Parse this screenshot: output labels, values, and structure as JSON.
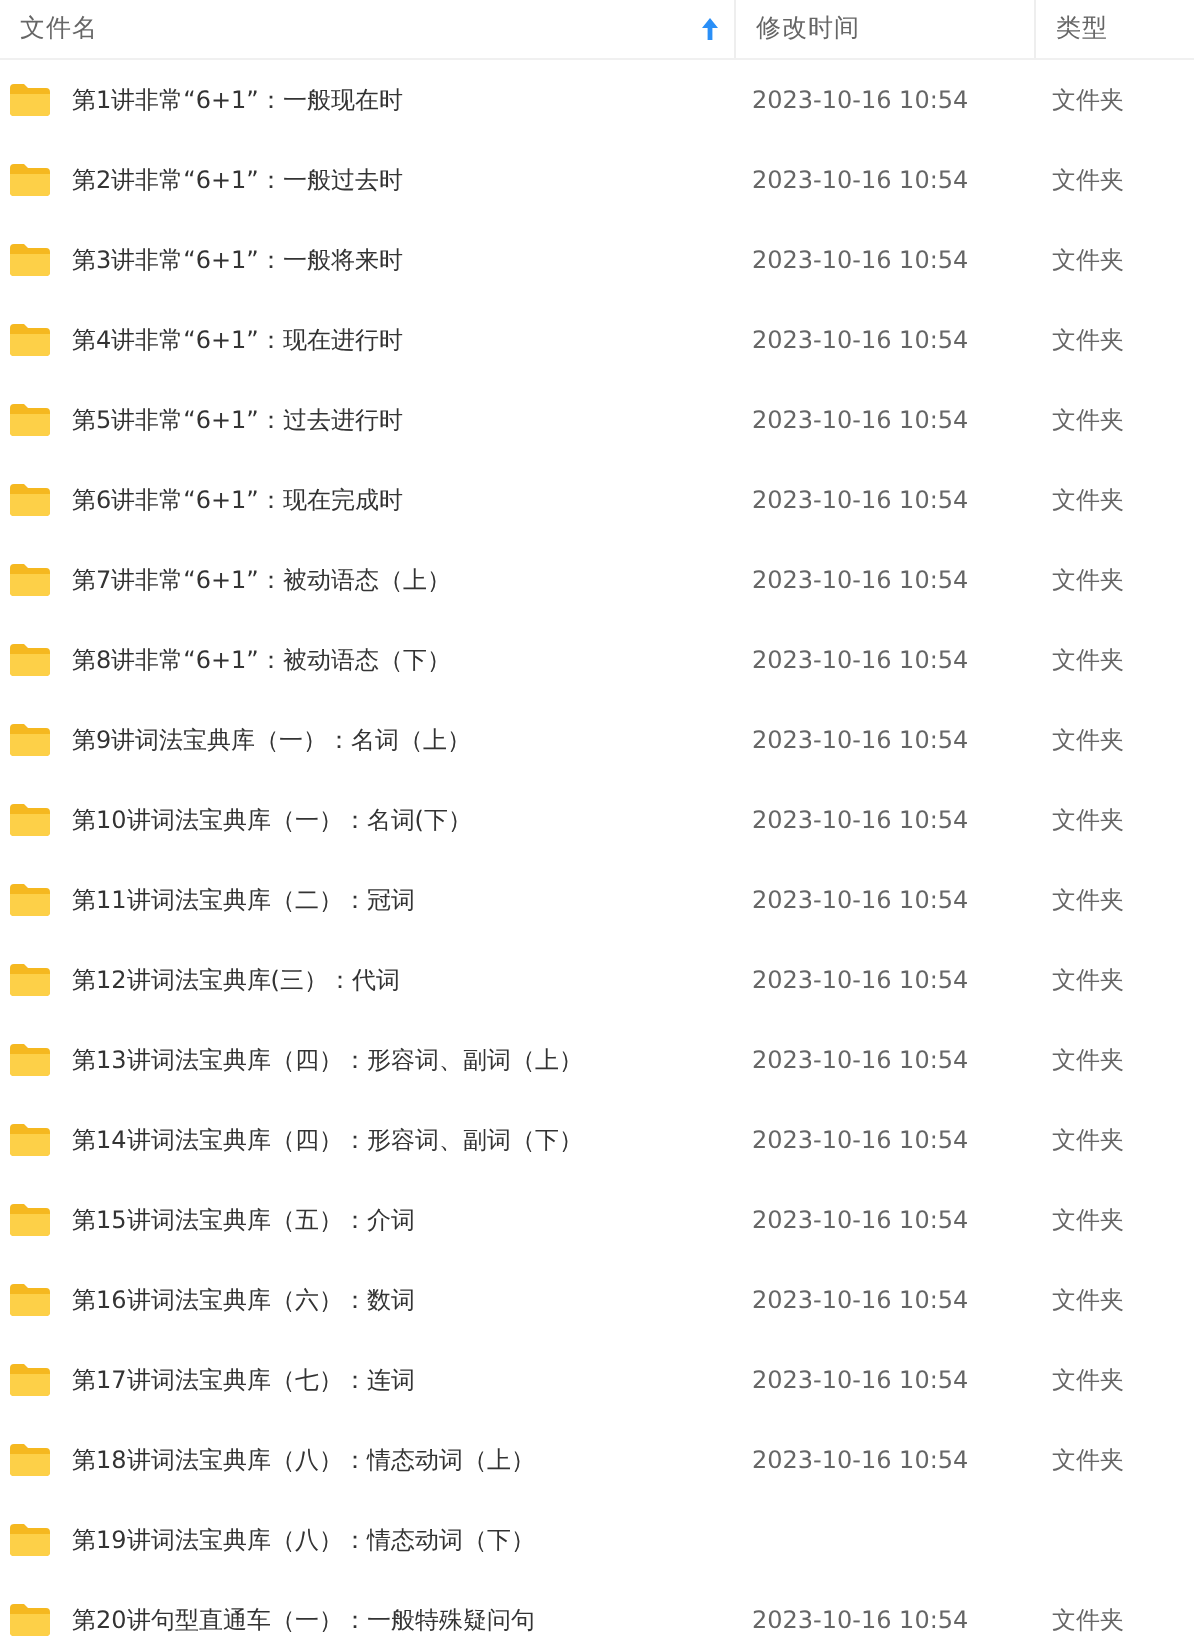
{
  "columns": [
    {
      "label": "文件名",
      "sort_icon": true
    },
    {
      "label": "修改时间",
      "sort_icon": false
    },
    {
      "label": "类型",
      "sort_icon": false
    }
  ],
  "rows": [
    {
      "name": "第1讲非常“6+1”：一般现在时",
      "modified": "2023-10-16 10:54",
      "type": "文件夹"
    },
    {
      "name": "第2讲非常“6+1”：一般过去时",
      "modified": "2023-10-16 10:54",
      "type": "文件夹"
    },
    {
      "name": "第3讲非常“6+1”：一般将来时",
      "modified": "2023-10-16 10:54",
      "type": "文件夹"
    },
    {
      "name": "第4讲非常“6+1”：现在进行时",
      "modified": "2023-10-16 10:54",
      "type": "文件夹"
    },
    {
      "name": "第5讲非常“6+1”：过去进行时",
      "modified": "2023-10-16 10:54",
      "type": "文件夹"
    },
    {
      "name": "第6讲非常“6+1”：现在完成时",
      "modified": "2023-10-16 10:54",
      "type": "文件夹"
    },
    {
      "name": "第7讲非常“6+1”：被动语态（上）",
      "modified": "2023-10-16 10:54",
      "type": "文件夹"
    },
    {
      "name": "第8讲非常“6+1”：被动语态（下）",
      "modified": "2023-10-16 10:54",
      "type": "文件夹"
    },
    {
      "name": "第9讲词法宝典库（一）：名词（上）",
      "modified": "2023-10-16 10:54",
      "type": "文件夹"
    },
    {
      "name": "第10讲词法宝典库（一）：名词(下）",
      "modified": "2023-10-16 10:54",
      "type": "文件夹"
    },
    {
      "name": "第11讲词法宝典库（二）：冠词",
      "modified": "2023-10-16 10:54",
      "type": "文件夹"
    },
    {
      "name": "第12讲词法宝典库(三）：代词",
      "modified": "2023-10-16 10:54",
      "type": "文件夹"
    },
    {
      "name": "第13讲词法宝典库（四）：形容词、副词（上）",
      "modified": "2023-10-16 10:54",
      "type": "文件夹"
    },
    {
      "name": "第14讲词法宝典库（四）：形容词、副词（下）",
      "modified": "2023-10-16 10:54",
      "type": "文件夹"
    },
    {
      "name": "第15讲词法宝典库（五）：介词",
      "modified": "2023-10-16 10:54",
      "type": "文件夹"
    },
    {
      "name": "第16讲词法宝典库（六）：数词",
      "modified": "2023-10-16 10:54",
      "type": "文件夹"
    },
    {
      "name": "第17讲词法宝典库（七）：连词",
      "modified": "2023-10-16 10:54",
      "type": "文件夹"
    },
    {
      "name": "第18讲词法宝典库（八）：情态动词（上）",
      "modified": "2023-10-16 10:54",
      "type": "文件夹"
    },
    {
      "name": "第19讲词法宝典库（八）：情态动词（下）"
    },
    {
      "name": "第20讲句型直通车（一）：一般特殊疑问句",
      "modified": "2023-10-16 10:54",
      "type": "文件夹"
    }
  ]
}
